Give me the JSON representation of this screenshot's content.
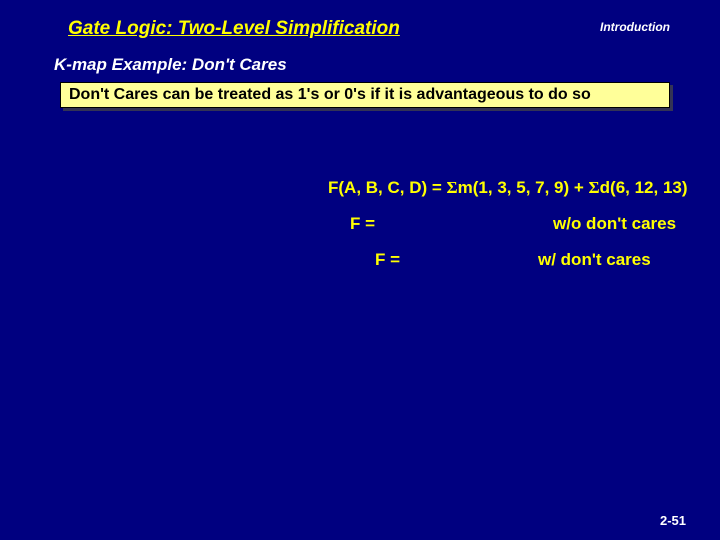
{
  "header": {
    "title": "Gate Logic:  Two-Level Simplification",
    "corner": "Introduction"
  },
  "subtitle": "K-map Example: Don't Cares",
  "box": "Don't Cares can be treated as 1's or 0's if it is advantageous to do so",
  "func": {
    "lhs": "F(A, B, C, D) = ",
    "m": "m(1, 3, 5, 7, 9) + ",
    "d": "d(6, 12, 13)"
  },
  "rows": {
    "f_eq": "F =",
    "wo": "w/o don't cares",
    "w": "w/ don't cares"
  },
  "pagenum": "2-51"
}
